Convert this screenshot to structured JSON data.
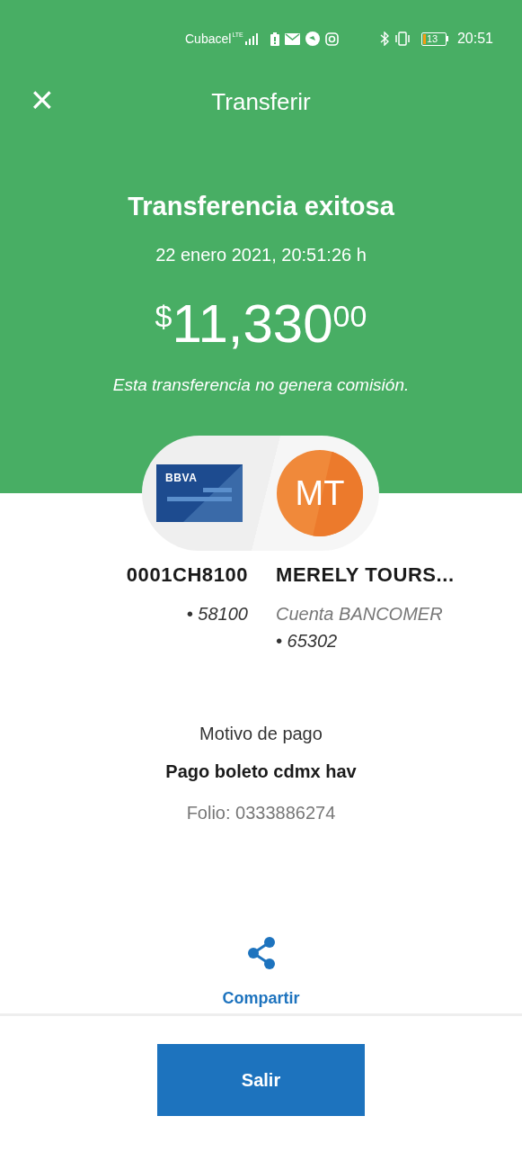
{
  "status_bar": {
    "carrier": "Cubacel",
    "network": "LTE",
    "time": "20:51",
    "battery": "13"
  },
  "header": {
    "close": "×",
    "title": "Transferir"
  },
  "result": {
    "title": "Transferencia exitosa",
    "date": "22 enero 2021, 20:51:26 h",
    "currency": "$",
    "amount": "11,330",
    "cents": "00",
    "note": "Esta transferencia no genera comisión."
  },
  "origin": {
    "card_brand": "BBVA",
    "name": "0001CH8100",
    "account": "• 58100"
  },
  "destination": {
    "initials": "MT",
    "name": "MERELY TOURS...",
    "bank": "Cuenta BANCOMER",
    "account": "• 65302"
  },
  "details": {
    "label": "Motivo de pago",
    "reason": "Pago boleto cdmx hav",
    "folio": "Folio: 0333886274"
  },
  "share": {
    "label": "Compartir"
  },
  "exit_button": "Salir"
}
